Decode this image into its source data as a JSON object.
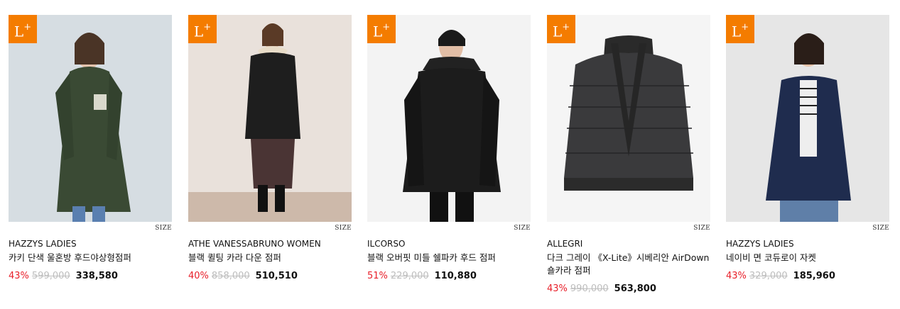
{
  "badge": {
    "main": "L",
    "sup": "+"
  },
  "products": [
    {
      "brand": "HAZZYS LADIES",
      "name": "카키 단색 울혼방 후드야상형점퍼",
      "discount": "43%",
      "original_price": "599,000",
      "sale_price": "338,580",
      "size_label": "SIZE",
      "bg": "#d6dde2"
    },
    {
      "brand": "ATHE VANESSABRUNO WOMEN",
      "name": "블랙 퀼팅 카라 다운 점퍼",
      "discount": "40%",
      "original_price": "858,000",
      "sale_price": "510,510",
      "size_label": "SIZE",
      "bg": "#e9e1db"
    },
    {
      "brand": "ILCORSO",
      "name": "블랙 오버핏 미들 쉘파카 후드 점퍼",
      "discount": "51%",
      "original_price": "229,000",
      "sale_price": "110,880",
      "size_label": "SIZE",
      "bg": "#f3f3f3"
    },
    {
      "brand": "ALLEGRI",
      "name": "다크 그레이 《X-Lite》시베리안 AirDown 숄카라 점퍼",
      "discount": "43%",
      "original_price": "990,000",
      "sale_price": "563,800",
      "size_label": "SIZE",
      "bg": "#f5f5f5"
    },
    {
      "brand": "HAZZYS LADIES",
      "name": "네이비 면 코듀로이 자켓",
      "discount": "43%",
      "original_price": "329,000",
      "sale_price": "185,960",
      "size_label": "SIZE",
      "bg": "#e6e6e6"
    }
  ]
}
